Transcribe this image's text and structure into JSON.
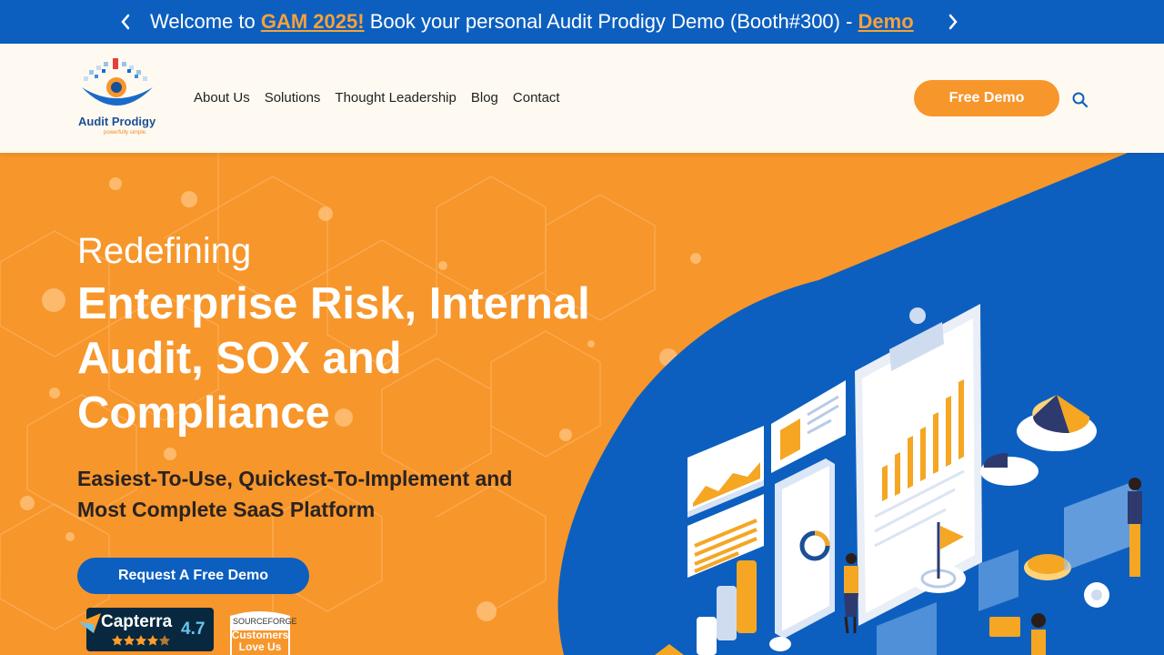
{
  "announcement": {
    "prefix": "Welcome to ",
    "event_link": "GAM 2025!",
    "middle": " Book your personal Audit Prodigy Demo (Booth#300) - ",
    "demo_link": "Demo"
  },
  "logo": {
    "name": "Audit Prodigy",
    "tagline": "powerfully simple."
  },
  "nav": {
    "items": [
      {
        "label": "About Us"
      },
      {
        "label": "Solutions"
      },
      {
        "label": "Thought Leadership"
      },
      {
        "label": "Blog"
      },
      {
        "label": "Contact"
      }
    ]
  },
  "header": {
    "cta_label": "Free Demo"
  },
  "hero": {
    "eyebrow": "Redefining",
    "headline": "Enterprise Risk, Internal Audit, SOX and Compliance",
    "subheadline": "Easiest-To-Use, Quickest-To-Implement and Most Complete SaaS Platform",
    "cta_label": "Request A Free Demo"
  },
  "badges": {
    "capterra_name": "Capterra",
    "capterra_rating": "4.7",
    "sourceforge_name": "SOURCEFORGE",
    "sourceforge_text_1": "Customers",
    "sourceforge_text_2": "Love Us"
  },
  "colors": {
    "brand_blue": "#0c5fbf",
    "brand_orange": "#f7962b",
    "header_bg": "#fffaf1"
  }
}
